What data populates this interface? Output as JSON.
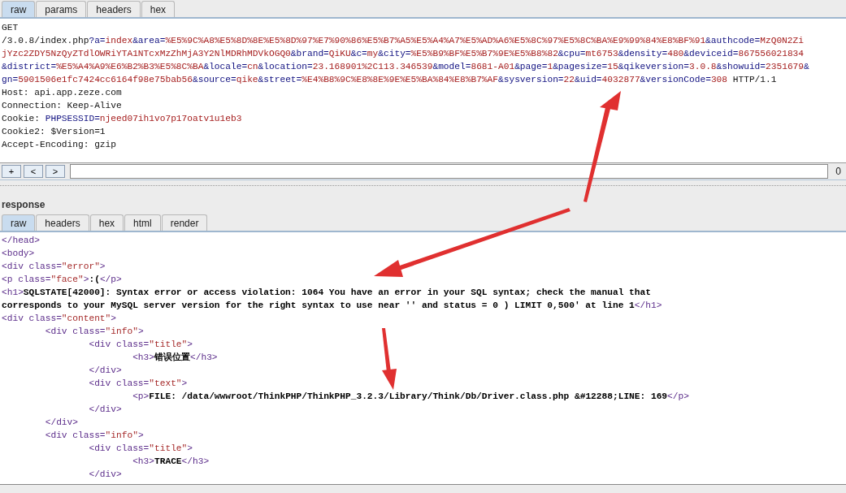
{
  "request": {
    "tabs": [
      {
        "label": "raw",
        "selected": true
      },
      {
        "label": "params",
        "selected": false
      },
      {
        "label": "headers",
        "selected": false
      },
      {
        "label": "hex",
        "selected": false
      }
    ],
    "lines": [
      {
        "text": "GET",
        "kind": "plain"
      },
      {
        "text": "/3.0.8/index.php?a=index&area=%E5%9C%A8%E5%8D%8E%E5%8D%97%E7%90%86%E5%B7%A5%E5%A4%A7%E5%AD%A6%E5%8C%97%E5%8C%BA%E9%99%84%E8%BF%91&authcode=MzQ0N2Zi",
        "kind": "query"
      },
      {
        "text": "jYzc2ZDY5NzQyZTdlOWRiYTA1NTcxMzZhMjA3Y2NlMDRhMDVkOGQ0&brand=QiKU&c=my&city=%E5%B9%BF%E5%B7%9E%E5%B8%82&cpu=mt6753&density=480&deviceid=867556021834",
        "kind": "valuecont"
      },
      {
        "text": "&district=%E5%A4%A9%E6%B2%B3%E5%8C%BA&locale=cn&location=23.168901%2C113.346539&model=8681-A01&page=1&pagesize=15&qikeversion=3.0.8&showuid=2351679&",
        "kind": "valuecont"
      },
      {
        "text": "gn=5901506e1fc7424cc6164f98e75bab56&source=qike&street=%E4%B8%9C%E8%8E%9E%E5%BA%84%E8%B7%AF&sysversion=22&uid=4032877&versionCode=308 HTTP/1.1",
        "kind": "namecont"
      },
      {
        "text": "Host: api.app.zeze.com",
        "kind": "plain"
      },
      {
        "text": "Connection: Keep-Alive",
        "kind": "plain"
      },
      {
        "text": "Cookie: PHPSESSID=njeed07ih1vo7p17oatv1u1eb3",
        "kind": "cookie"
      },
      {
        "text": "Cookie2: $Version=1",
        "kind": "plain"
      },
      {
        "text": "Accept-Encoding: gzip",
        "kind": "plain"
      }
    ],
    "toolbar": {
      "buttons": [
        "+",
        "<",
        ">"
      ],
      "count": "0"
    }
  },
  "response": {
    "title": "response",
    "tabs": [
      {
        "label": "raw",
        "selected": true
      },
      {
        "label": "headers",
        "selected": false
      },
      {
        "label": "hex",
        "selected": false
      },
      {
        "label": "html",
        "selected": false
      },
      {
        "label": "render",
        "selected": false
      }
    ],
    "lines": [
      "</head>",
      "<body>",
      "<div class=\"error\">",
      "<p class=\"face\">:(</p>",
      "<h1>SQLSTATE[42000]: Syntax error or access violation: 1064 You have an error in your SQL syntax; check the manual that",
      "corresponds to your MySQL server version for the right syntax to use near '' and status = 0 ) LIMIT 0,500' at line 1</h1>",
      "<div class=\"content\">",
      "\t<div class=\"info\">",
      "\t\t<div class=\"title\">",
      "\t\t\t<h3>错误位置</h3>",
      "\t\t</div>",
      "\t\t<div class=\"text\">",
      "\t\t\t<p>FILE: /data/wwwroot/ThinkPHP/ThinkPHP_3.2.3/Library/Think/Db/Driver.class.php &#12288;LINE: 169</p>",
      "\t\t</div>",
      "\t</div>",
      "\t<div class=\"info\">",
      "\t\t<div class=\"title\">",
      "\t\t\t<h3>TRACE</h3>",
      "\t\t</div>"
    ]
  }
}
